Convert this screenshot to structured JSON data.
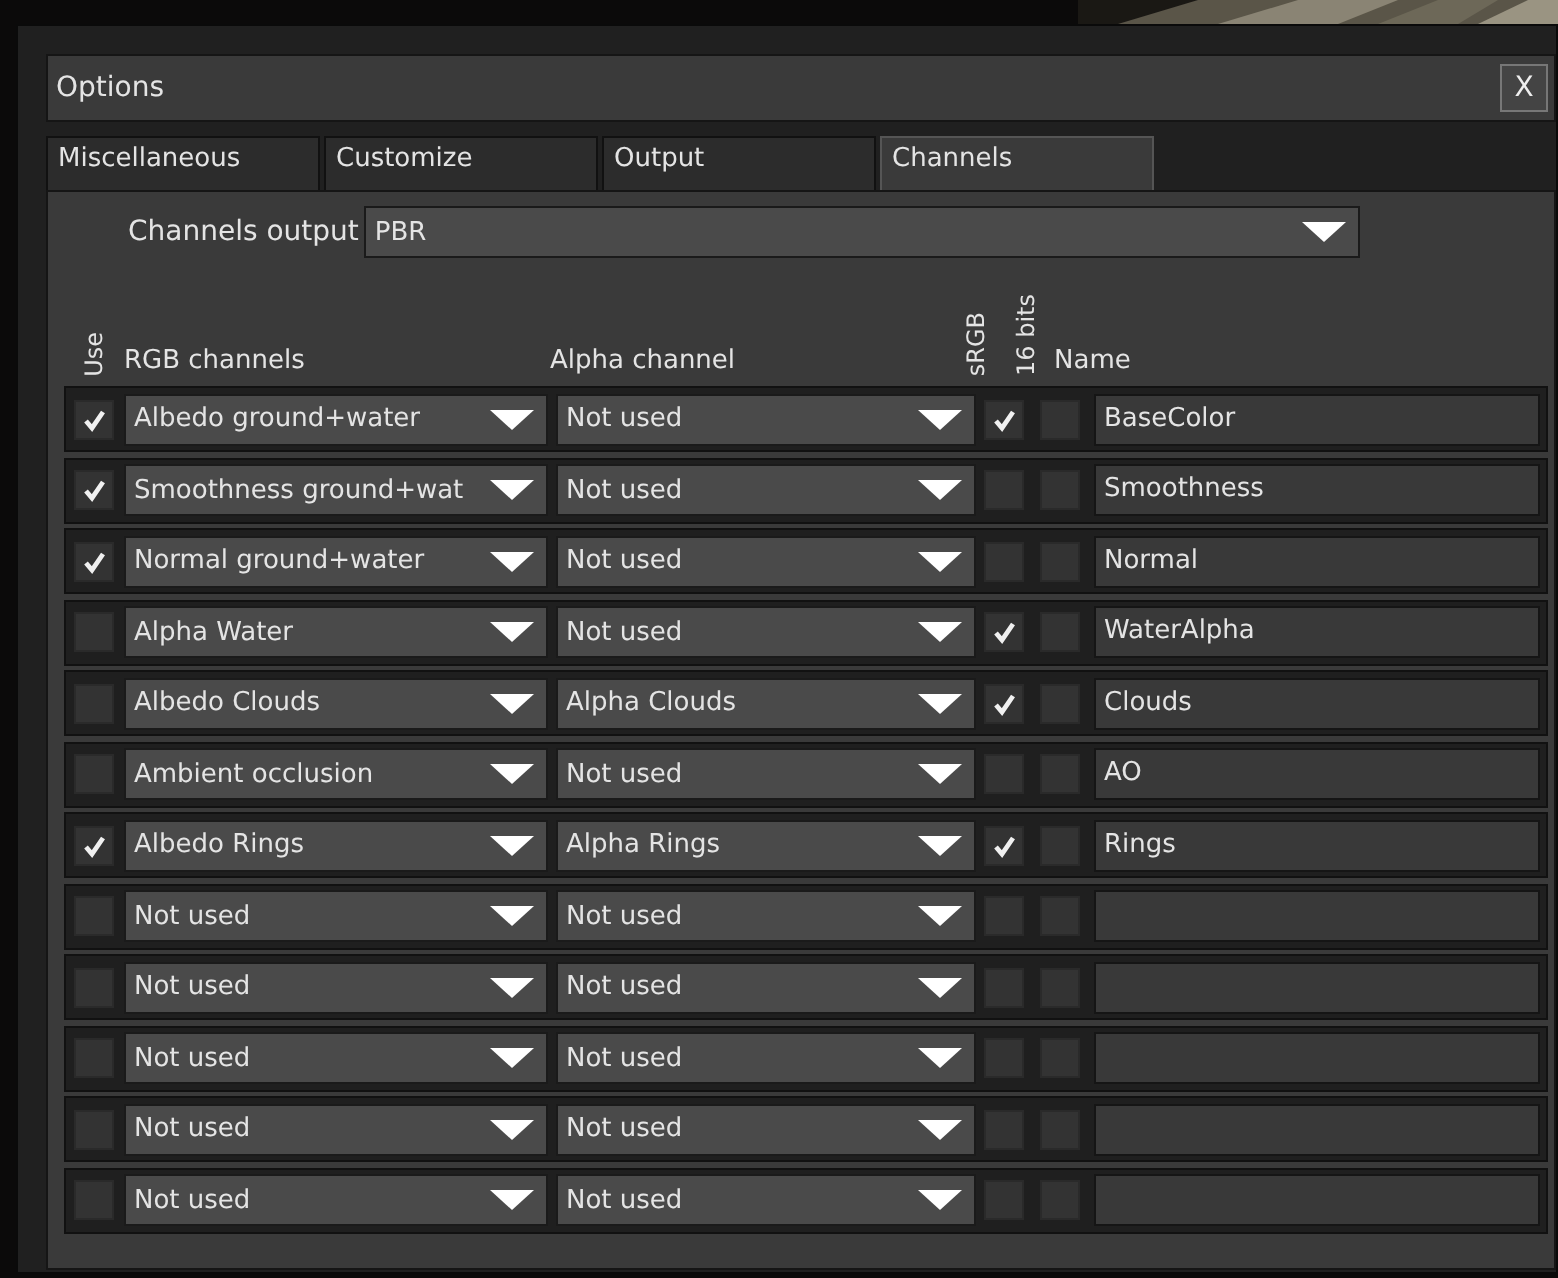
{
  "window": {
    "title": "Options",
    "close": "X"
  },
  "tabs": [
    {
      "label": "Miscellaneous",
      "selected": false
    },
    {
      "label": "Customize",
      "selected": false
    },
    {
      "label": "Output",
      "selected": false
    },
    {
      "label": "Channels",
      "selected": true
    }
  ],
  "channels_output": {
    "label": "Channels output",
    "value": "PBR"
  },
  "columns": {
    "use": "Use",
    "rgb": "RGB channels",
    "alpha": "Alpha channel",
    "srgb": "sRGB",
    "bits16": "16 bits",
    "name": "Name"
  },
  "rows": [
    {
      "use": true,
      "rgb": "Albedo ground+water",
      "alpha": "Not used",
      "srgb": true,
      "bits16": false,
      "name": "BaseColor"
    },
    {
      "use": true,
      "rgb": "Smoothness ground+wat",
      "alpha": "Not used",
      "srgb": false,
      "bits16": false,
      "name": "Smoothness"
    },
    {
      "use": true,
      "rgb": "Normal ground+water",
      "alpha": "Not used",
      "srgb": false,
      "bits16": false,
      "name": "Normal"
    },
    {
      "use": false,
      "rgb": "Alpha Water",
      "alpha": "Not used",
      "srgb": true,
      "bits16": false,
      "name": "WaterAlpha"
    },
    {
      "use": false,
      "rgb": "Albedo Clouds",
      "alpha": "Alpha Clouds",
      "srgb": true,
      "bits16": false,
      "name": "Clouds"
    },
    {
      "use": false,
      "rgb": "Ambient occlusion",
      "alpha": "Not used",
      "srgb": false,
      "bits16": false,
      "name": "AO"
    },
    {
      "use": true,
      "rgb": "Albedo Rings",
      "alpha": "Alpha Rings",
      "srgb": true,
      "bits16": false,
      "name": "Rings"
    },
    {
      "use": false,
      "rgb": "Not used",
      "alpha": "Not used",
      "srgb": false,
      "bits16": false
    },
    {
      "use": false,
      "rgb": "Not used",
      "alpha": "Not used",
      "srgb": false,
      "bits16": false
    },
    {
      "use": false,
      "rgb": "Not used",
      "alpha": "Not used",
      "srgb": false,
      "bits16": false
    },
    {
      "use": false,
      "rgb": "Not used",
      "alpha": "Not used",
      "srgb": false,
      "bits16": false
    },
    {
      "use": false,
      "rgb": "Not used",
      "alpha": "Not used",
      "srgb": false,
      "bits16": false
    }
  ]
}
